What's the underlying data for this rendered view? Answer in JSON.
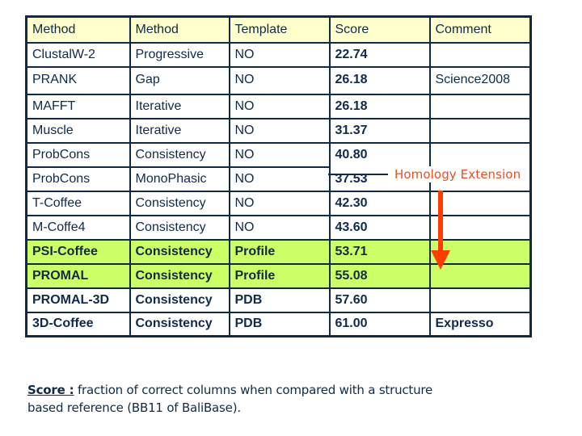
{
  "table": {
    "headers": [
      "Method",
      "Method",
      "Template",
      "Score",
      "Comment"
    ],
    "rows": [
      {
        "method": "ClustalW-2",
        "type": "Progressive",
        "template": "NO",
        "score": "22.74",
        "comment": ""
      },
      {
        "method": "PRANK",
        "type": "Gap",
        "template": "NO",
        "score": "26.18",
        "comment": "Science2008"
      },
      {
        "method": "MAFFT",
        "type": "Iterative",
        "template": "NO",
        "score": "26.18",
        "comment": ""
      },
      {
        "method": "Muscle",
        "type": "Iterative",
        "template": "NO",
        "score": "31.37",
        "comment": ""
      },
      {
        "method": "ProbCons",
        "type": "Consistency",
        "template": "NO",
        "score": "40.80",
        "comment": ""
      },
      {
        "method": "ProbCons",
        "type": "MonoPhasic",
        "template": "NO",
        "score": "37.53",
        "comment": ""
      },
      {
        "method": "T-Coffee",
        "type": "Consistency",
        "template": "NO",
        "score": "42.30",
        "comment": ""
      },
      {
        "method": "M-Coffe4",
        "type": "Consistency",
        "template": "NO",
        "score": "43.60",
        "comment": ""
      },
      {
        "method": "PSI-Coffee",
        "type": "Consistency",
        "template": "Profile",
        "score": "53.71",
        "comment": ""
      },
      {
        "method": "PROMAL",
        "type": "Consistency",
        "template": "Profile",
        "score": "55.08",
        "comment": ""
      },
      {
        "method": "PROMAL-3D",
        "type": "Consistency",
        "template": "PDB",
        "score": "57.60",
        "comment": ""
      },
      {
        "method": "3D-Coffee",
        "type": "Consistency",
        "template": "PDB",
        "score": "61.00",
        "comment": "Expresso"
      }
    ]
  },
  "annotation": {
    "label": "Homology Extension",
    "arrow_color": "#ff3c00",
    "label_color": "#e8501e"
  },
  "footnote": {
    "term": "Score :",
    "text_line1": " fraction of correct columns when compared with a structure",
    "text_line2": "based reference (BB11 of BaliBase)."
  },
  "colors": {
    "header_bg": "#ffffcc",
    "highlight_bg": "#ccff66",
    "border": "#0f2a4a",
    "text": "#0f2a4a"
  }
}
